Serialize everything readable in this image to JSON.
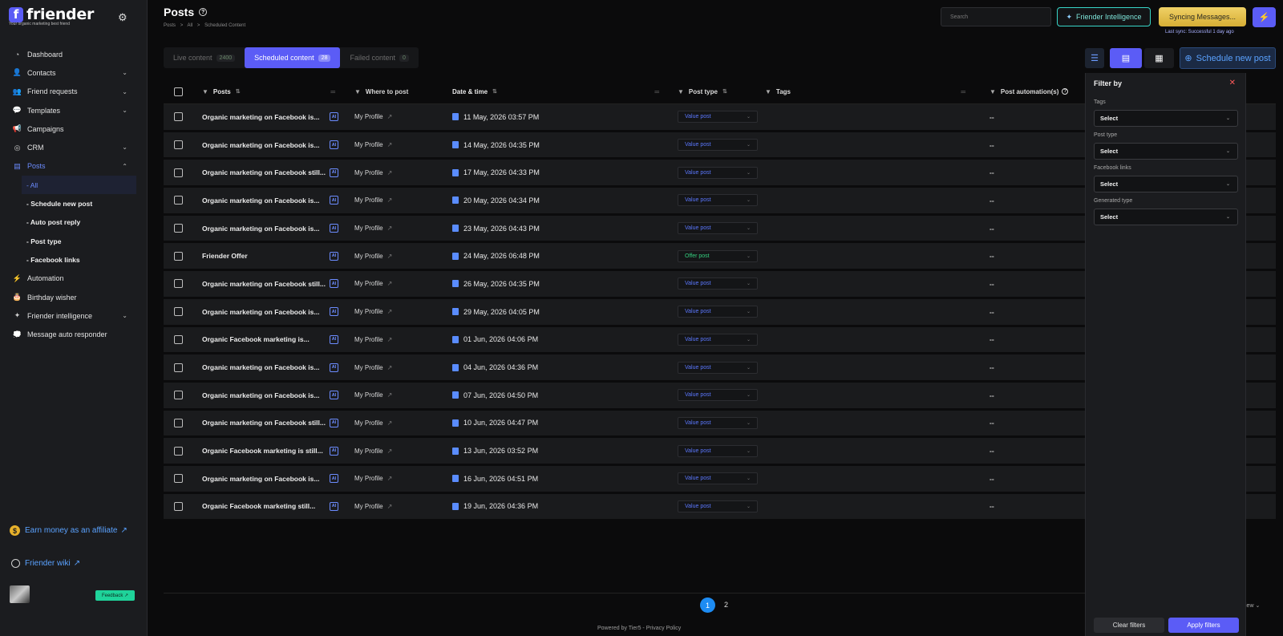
{
  "brand": {
    "name": "friender",
    "logo_letter": "f",
    "tagline": "Your organic marketing best friend"
  },
  "sidebar": {
    "items": [
      {
        "label": "Dashboard",
        "icon": "pie-chart-icon",
        "glyph": "◔",
        "chevron": ""
      },
      {
        "label": "Contacts",
        "icon": "contacts-icon",
        "glyph": "👤",
        "chevron": "⌄"
      },
      {
        "label": "Friend requests",
        "icon": "friend-request-icon",
        "glyph": "👥",
        "chevron": "⌄"
      },
      {
        "label": "Templates",
        "icon": "templates-icon",
        "glyph": "💬",
        "chevron": "⌄"
      },
      {
        "label": "Campaigns",
        "icon": "megaphone-icon",
        "glyph": "📢",
        "chevron": ""
      },
      {
        "label": "CRM",
        "icon": "crm-icon",
        "glyph": "◎",
        "chevron": "⌄"
      },
      {
        "label": "Posts",
        "icon": "posts-icon",
        "glyph": "▤",
        "chevron": "⌃"
      }
    ],
    "sub_items": [
      "- All",
      "- Schedule new post",
      "- Auto post reply",
      "- Post type",
      "- Facebook links"
    ],
    "items_after": [
      {
        "label": "Automation",
        "icon": "bolt-icon",
        "glyph": "⚡",
        "chevron": ""
      },
      {
        "label": "Birthday wisher",
        "icon": "cake-icon",
        "glyph": "🎂",
        "chevron": ""
      },
      {
        "label": "Friender intelligence",
        "icon": "sparkle-icon",
        "glyph": "✦",
        "chevron": "⌄"
      },
      {
        "label": "Message auto responder",
        "icon": "chat-icon",
        "glyph": "💭",
        "chevron": ""
      }
    ],
    "affiliate": "Earn money as an affiliate",
    "coin_symbol": "$",
    "wiki": "Friender wiki",
    "external_symbol": "↗",
    "feedback": "Feedback ↗"
  },
  "header": {
    "title": "Posts",
    "breadcrumb": [
      "Posts",
      ">",
      "All",
      ">",
      "Scheduled Content"
    ],
    "search_placeholder": "Search",
    "intelligence_button": "Friender Intelligence",
    "sync_button": "Syncing Messages...",
    "sync_note": "Last sync: Successful 1 day ago"
  },
  "tabs": [
    {
      "label": "Live content",
      "count": "2400"
    },
    {
      "label": "Scheduled content",
      "count": "28"
    },
    {
      "label": "Failed content",
      "count": "0"
    }
  ],
  "toolbar": {
    "new_post": "Schedule new post"
  },
  "table": {
    "columns": [
      "Posts",
      "Where to post",
      "Date & time",
      "Post type",
      "Tags",
      "Post automation(s)"
    ],
    "rows": [
      {
        "post": "Organic marketing on Facebook is...",
        "where": "My Profile",
        "date": "11 May, 2026 03:57 PM",
        "type": "Value post",
        "automation": "--"
      },
      {
        "post": "Organic marketing on Facebook is...",
        "where": "My Profile",
        "date": "14 May, 2026 04:35 PM",
        "type": "Value post",
        "automation": "--"
      },
      {
        "post": "Organic marketing on Facebook still...",
        "where": "My Profile",
        "date": "17 May, 2026 04:33 PM",
        "type": "Value post",
        "automation": "--"
      },
      {
        "post": "Organic marketing on Facebook is...",
        "where": "My Profile",
        "date": "20 May, 2026 04:34 PM",
        "type": "Value post",
        "automation": "--"
      },
      {
        "post": "Organic marketing on Facebook is...",
        "where": "My Profile",
        "date": "23 May, 2026 04:43 PM",
        "type": "Value post",
        "automation": "--"
      },
      {
        "post": "Friender Offer",
        "where": "My Profile",
        "date": "24 May, 2026 06:48 PM",
        "type": "Offer post",
        "automation": "--"
      },
      {
        "post": "Organic marketing on Facebook still...",
        "where": "My Profile",
        "date": "26 May, 2026 04:35 PM",
        "type": "Value post",
        "automation": "--"
      },
      {
        "post": "Organic marketing on Facebook is...",
        "where": "My Profile",
        "date": "29 May, 2026 04:05 PM",
        "type": "Value post",
        "automation": "--"
      },
      {
        "post": "Organic Facebook marketing is...",
        "where": "My Profile",
        "date": "01 Jun, 2026 04:06 PM",
        "type": "Value post",
        "automation": "--"
      },
      {
        "post": "Organic marketing on Facebook is...",
        "where": "My Profile",
        "date": "04 Jun, 2026 04:36 PM",
        "type": "Value post",
        "automation": "--"
      },
      {
        "post": "Organic marketing on Facebook is...",
        "where": "My Profile",
        "date": "07 Jun, 2026 04:50 PM",
        "type": "Value post",
        "automation": "--"
      },
      {
        "post": "Organic marketing on Facebook still...",
        "where": "My Profile",
        "date": "10 Jun, 2026 04:47 PM",
        "type": "Value post",
        "automation": "--"
      },
      {
        "post": "Organic Facebook marketing is still...",
        "where": "My Profile",
        "date": "13 Jun, 2026 03:52 PM",
        "type": "Value post",
        "automation": "--"
      },
      {
        "post": "Organic marketing on Facebook is...",
        "where": "My Profile",
        "date": "16 Jun, 2026 04:51 PM",
        "type": "Value post",
        "automation": "--"
      },
      {
        "post": "Organic Facebook marketing still...",
        "where": "My Profile",
        "date": "19 Jun, 2026 04:36 PM",
        "type": "Value post",
        "automation": "--"
      }
    ]
  },
  "pagination": {
    "pages": [
      "1",
      "2"
    ],
    "current": "1"
  },
  "view_label": "iew",
  "footer": "Powered by Tier5 - Privacy Policy",
  "filter_panel": {
    "title": "Filter by",
    "close": "✕",
    "fields": [
      {
        "label": "Tags",
        "value": "Select"
      },
      {
        "label": "Post type",
        "value": "Select"
      },
      {
        "label": "Facebook links",
        "value": "Select"
      },
      {
        "label": "Generated type",
        "value": "Select"
      }
    ],
    "clear": "Clear filters",
    "apply": "Apply filters"
  },
  "colors": {
    "accent": "#5b5cf6",
    "link": "#5aa2ff",
    "value_post": "#5b78ff",
    "offer_post": "#35d07f",
    "sync": "#e6c14a"
  }
}
